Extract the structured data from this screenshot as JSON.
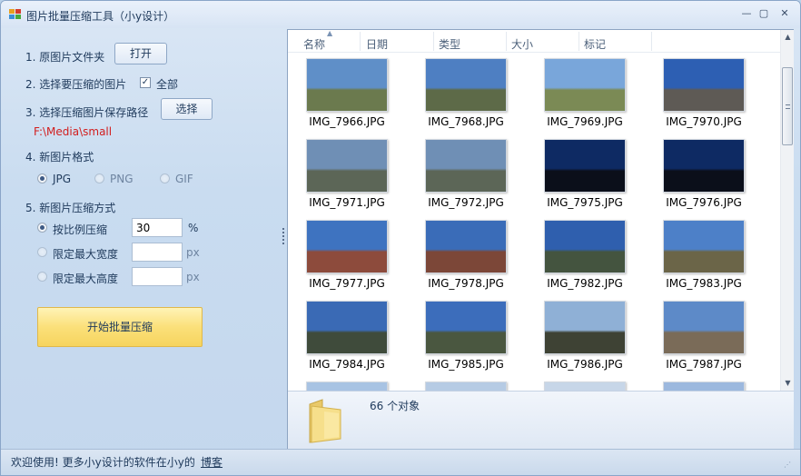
{
  "window": {
    "title": "图片批量压缩工具（小y设计）",
    "controls": {
      "minimize": "—",
      "maximize": "▢",
      "close": "✕"
    }
  },
  "left": {
    "step1_label": "1. 原图片文件夹",
    "open_button": "打开",
    "step2_label": "2. 选择要压缩的图片",
    "select_all_label": "全部",
    "select_all_checked": true,
    "step3_label": "3. 选择压缩图片保存路径",
    "choose_button": "选择",
    "save_path": "F:\\Media\\small",
    "step4_label": "4. 新图片格式",
    "formats": [
      {
        "label": "JPG",
        "checked": true
      },
      {
        "label": "PNG",
        "checked": false
      },
      {
        "label": "GIF",
        "checked": false
      }
    ],
    "step5_label": "5. 新图片压缩方式",
    "methods": [
      {
        "label": "按比例压缩",
        "value": "30",
        "unit": "%",
        "checked": true
      },
      {
        "label": "限定最大宽度",
        "value": "",
        "unit": "px",
        "checked": false
      },
      {
        "label": "限定最大高度",
        "value": "",
        "unit": "px",
        "checked": false
      }
    ],
    "start_button": "开始批量压缩"
  },
  "explorer": {
    "columns": [
      "名称",
      "日期",
      "类型",
      "大小",
      "标记"
    ],
    "items": [
      {
        "name": "IMG_7966.JPG",
        "sky": "#5f8fc8",
        "ground": "#6b7a4e"
      },
      {
        "name": "IMG_7968.JPG",
        "sky": "#4e7fc2",
        "ground": "#5d6a48"
      },
      {
        "name": "IMG_7969.JPG",
        "sky": "#79a6da",
        "ground": "#7b8a55"
      },
      {
        "name": "IMG_7970.JPG",
        "sky": "#2d5fb3",
        "ground": "#5e5a55"
      },
      {
        "name": "IMG_7971.JPG",
        "sky": "#6f8fb5",
        "ground": "#5c6657"
      },
      {
        "name": "IMG_7972.JPG",
        "sky": "#6f8fb5",
        "ground": "#5c6657"
      },
      {
        "name": "IMG_7975.JPG",
        "sky": "#0e2a63",
        "ground": "#0b0f1a"
      },
      {
        "name": "IMG_7976.JPG",
        "sky": "#0e2a63",
        "ground": "#0b0f1a"
      },
      {
        "name": "IMG_7977.JPG",
        "sky": "#3e73c0",
        "ground": "#8d4b3c"
      },
      {
        "name": "IMG_7978.JPG",
        "sky": "#3a6cb8",
        "ground": "#7c4738"
      },
      {
        "name": "IMG_7982.JPG",
        "sky": "#2f5fae",
        "ground": "#44543f"
      },
      {
        "name": "IMG_7983.JPG",
        "sky": "#4d80c8",
        "ground": "#6b6548"
      },
      {
        "name": "IMG_7984.JPG",
        "sky": "#3a6ab5",
        "ground": "#3f4b3b"
      },
      {
        "name": "IMG_7985.JPG",
        "sky": "#3c6dbb",
        "ground": "#4a5740"
      },
      {
        "name": "IMG_7986.JPG",
        "sky": "#8fb0d6",
        "ground": "#3e4234"
      },
      {
        "name": "IMG_7987.JPG",
        "sky": "#5d8ac8",
        "ground": "#7a6b58"
      },
      {
        "name": "",
        "sky": "#a8c3e3",
        "ground": "#a8c3e3"
      },
      {
        "name": "",
        "sky": "#b6cbe4",
        "ground": "#b6cbe4"
      },
      {
        "name": "",
        "sky": "#c7d6e8",
        "ground": "#c7d6e8"
      },
      {
        "name": "",
        "sky": "#9cb8de",
        "ground": "#9cb8de"
      }
    ],
    "object_count": "66 个对象"
  },
  "status": {
    "text": "欢迎使用! 更多小y设计的软件在小y的",
    "link": "博客"
  }
}
